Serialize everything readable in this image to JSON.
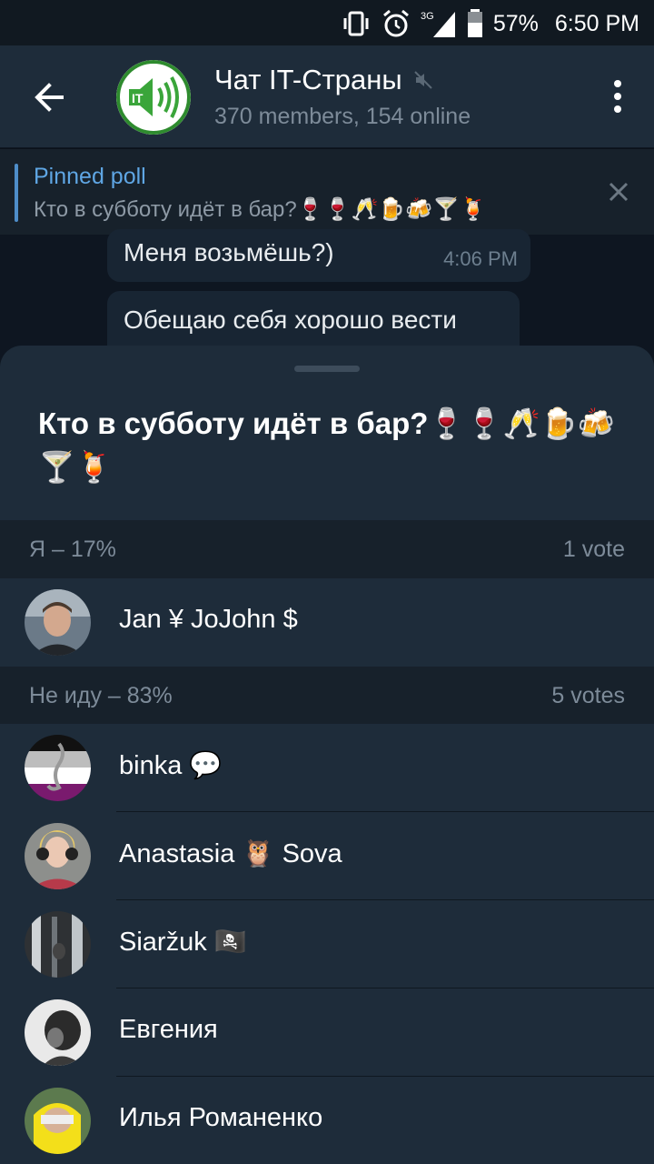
{
  "status_bar": {
    "battery": "57%",
    "time": "6:50 PM",
    "network": "3G",
    "icons": [
      "vibrate-icon",
      "alarm-icon",
      "signal-icon",
      "battery-icon"
    ]
  },
  "header": {
    "title": "Чат IT-Страны",
    "subtitle": "370 members, 154 online",
    "avatar_text": "IT",
    "icons": [
      "back-arrow-icon",
      "muted-icon",
      "more-vert-icon"
    ]
  },
  "pinned": {
    "title": "Pinned poll",
    "text": "Кто в субботу идёт в бар?🍷🍷🥂🍺🍻🍸🍹"
  },
  "messages": [
    {
      "text": "Меня возьмёшь?)",
      "time": "4:06 PM"
    },
    {
      "text": "Обещаю себя хорошо вести"
    }
  ],
  "poll": {
    "question": "Кто в субботу идёт в бар?🍷🍷🥂🍺🍻🍸🍹",
    "options": [
      {
        "label": "Я – 17%",
        "votes": "1 vote",
        "voters": [
          {
            "name": "Jan ¥ JoJohn $"
          }
        ]
      },
      {
        "label": "Не иду – 83%",
        "votes": "5 votes",
        "voters": [
          {
            "name": "binka 💬"
          },
          {
            "name": "Anastasia 🦉 Sova"
          },
          {
            "name": "Siaržuk 🏴‍☠️"
          },
          {
            "name": "Евгения"
          },
          {
            "name": "Илья Романенко"
          }
        ]
      }
    ]
  },
  "colors": {
    "accent": "#5fa6e4",
    "sheet_bg": "#1e2c3a",
    "section_bg": "#17212b"
  }
}
